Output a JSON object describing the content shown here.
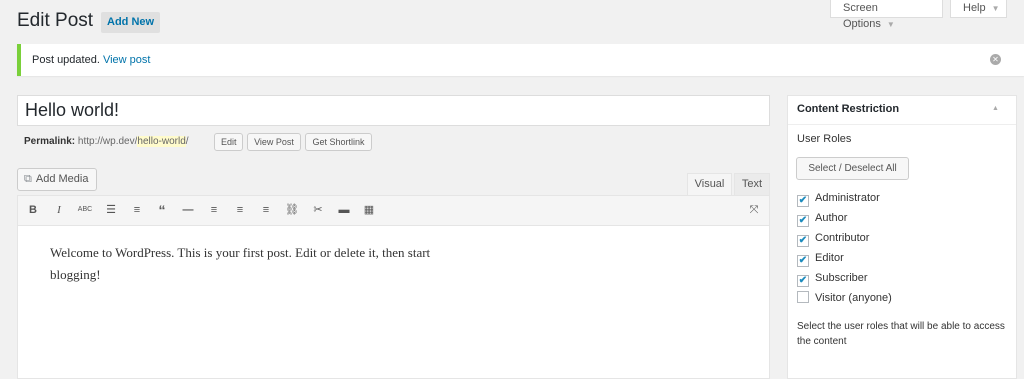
{
  "header": {
    "title": "Edit Post",
    "add_new": "Add New",
    "screen_options": "Screen Options",
    "help": "Help"
  },
  "notice": {
    "text": "Post updated.",
    "link": "View post"
  },
  "post": {
    "title": "Hello world!",
    "permalink_label": "Permalink:",
    "permalink_base": "http://wp.dev/",
    "permalink_slug": "hello-world",
    "permalink_trail": "/",
    "edit_btn": "Edit",
    "view_btn": "View Post",
    "shortlink_btn": "Get Shortlink"
  },
  "editor": {
    "add_media": "Add Media",
    "tab_visual": "Visual",
    "tab_text": "Text",
    "content_line1": "Welcome to WordPress. This is your first post. Edit or delete it, then start",
    "content_line2": "blogging!",
    "toolbar": [
      "bold-icon",
      "italic-icon",
      "strikethrough-icon",
      "bullet-list-icon",
      "numbered-list-icon",
      "blockquote-icon",
      "horizontal-rule-icon",
      "align-left-icon",
      "align-center-icon",
      "align-right-icon",
      "link-icon",
      "unlink-icon",
      "read-more-icon",
      "toolbar-toggle-icon",
      "fullscreen-icon"
    ]
  },
  "content_restriction": {
    "title": "Content Restriction",
    "roles_label": "User Roles",
    "select_all": "Select / Deselect All",
    "roles": [
      {
        "label": "Administrator",
        "checked": true
      },
      {
        "label": "Author",
        "checked": true
      },
      {
        "label": "Contributor",
        "checked": true
      },
      {
        "label": "Editor",
        "checked": true
      },
      {
        "label": "Subscriber",
        "checked": true
      },
      {
        "label": "Visitor (anyone)",
        "checked": false
      }
    ],
    "description": "Select the user roles that will be able to access the content"
  },
  "colors": {
    "accent": "#0073aa",
    "notice_border": "#7ad03a",
    "background": "#f1f1f1"
  }
}
